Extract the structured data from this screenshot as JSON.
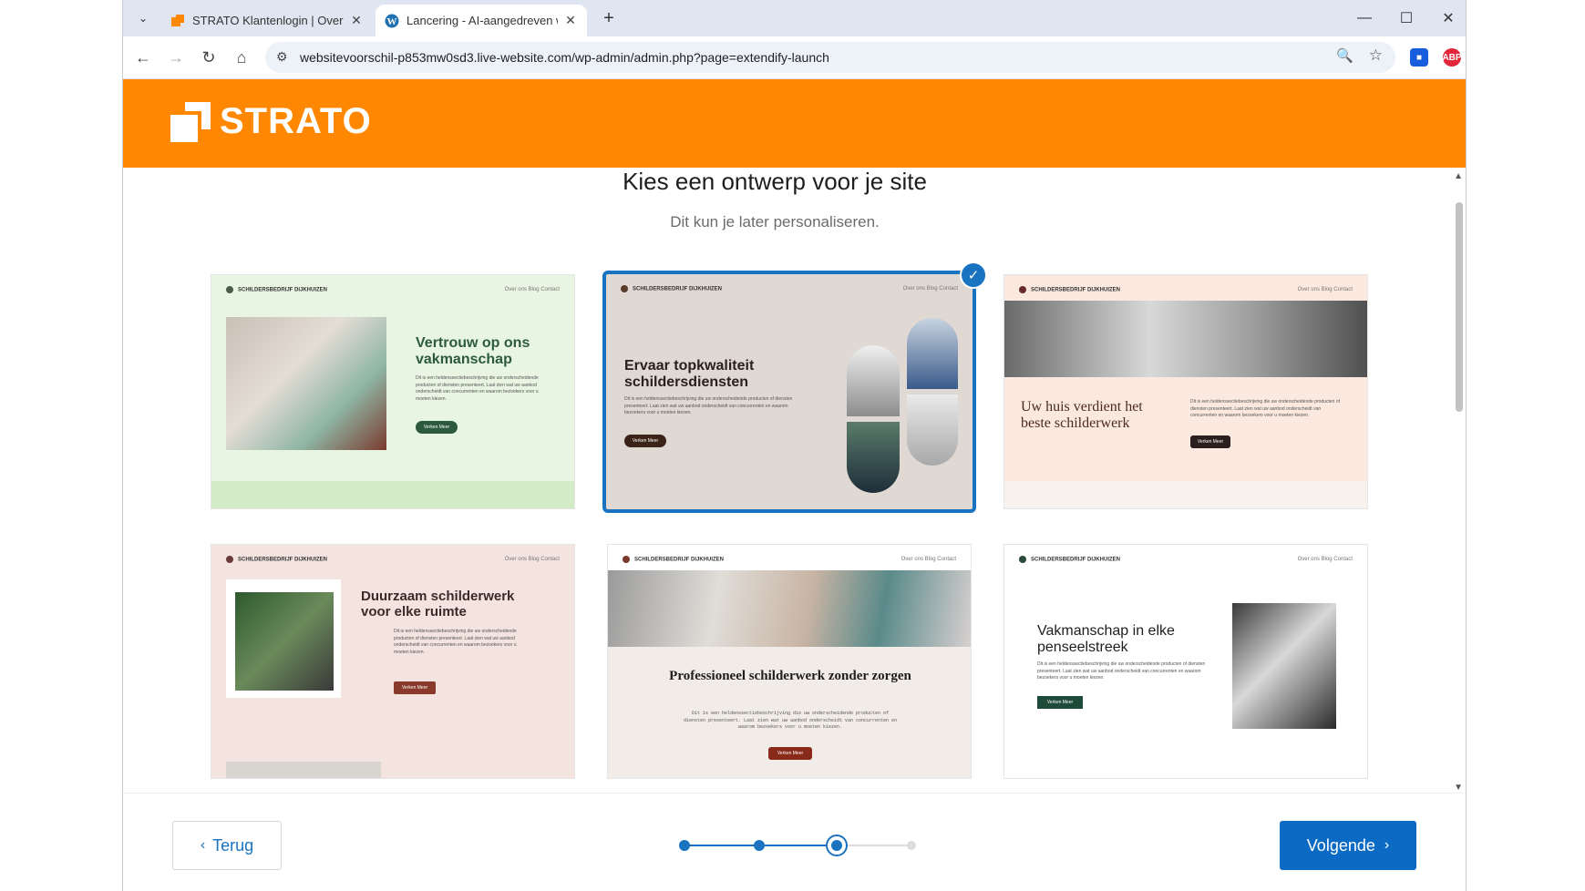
{
  "browser": {
    "tabs": [
      {
        "title": "STRATO Klantenlogin | Overzicht",
        "icon": "strato-icon",
        "active": false
      },
      {
        "title": "Lancering - AI-aangedreven website",
        "icon": "wordpress-icon",
        "active": true
      }
    ],
    "url": "websitevoorschil-p853mw0sd3.live-website.com/wp-admin/admin.php?page=extendify-launch",
    "extensions": [
      "bitwarden-icon",
      "adblock-icon",
      "extensions-icon",
      "profile-avatar"
    ]
  },
  "brand": {
    "name": "STRATO",
    "color": "#ff8800"
  },
  "page": {
    "heading": "Kies een ontwerp voor je site",
    "subheading": "Dit kun je later personaliseren."
  },
  "designs": [
    {
      "brand": "SCHILDERSBEDRIJF DIJKHUIZEN",
      "nav": "Over ons    Blog    Contact",
      "title": "Vertrouw op ons vakmanschap",
      "button": "Verken Meer",
      "bg": "#e8f5e2",
      "selected": false
    },
    {
      "brand": "SCHILDERSBEDRIJF DIJKHUIZEN",
      "nav": "Over ons    Blog    Contact",
      "title": "Ervaar topkwaliteit schildersdiensten",
      "button": "Verken Meer",
      "bg": "#e0d8d2",
      "selected": true
    },
    {
      "brand": "SCHILDERSBEDRIJF DIJKHUIZEN",
      "nav": "Over ons    Blog    Contact",
      "title": "Uw huis verdient het beste schilderwerk",
      "button": "Verken Meer",
      "bg": "#fbe9e0",
      "selected": false
    },
    {
      "brand": "SCHILDERSBEDRIJF DIJKHUIZEN",
      "nav": "Over ons    Blog    Contact",
      "title": "Duurzaam schilderwerk voor elke ruimte",
      "button": "Verken Meer",
      "bg": "#f3e4e0",
      "selected": false
    },
    {
      "brand": "SCHILDERSBEDRIJF DIJKHUIZEN",
      "nav": "Over ons    Blog    Contact",
      "title": "Professioneel schilderwerk zonder zorgen",
      "button": "Verken Meer",
      "bg": "#f1ece8",
      "selected": false
    },
    {
      "brand": "SCHILDERSBEDRIJF DIJKHUIZEN",
      "nav": "Over ons    Blog    Contact",
      "title": "Vakmanschap in elke penseelstreek",
      "button": "Verken Meer",
      "bg": "#ffffff",
      "selected": false
    }
  ],
  "placeholder_text": "Dit is een heldenssectiebeschrijving die uw onderscheidende producten of diensten presenteert. Laat zien wat uw aanbod onderscheidt van concurrenten en waarom bezoekers voor u moeten kiezen.",
  "footer": {
    "back_label": "Terug",
    "next_label": "Volgende",
    "steps_total": 4,
    "current_step": 3
  }
}
